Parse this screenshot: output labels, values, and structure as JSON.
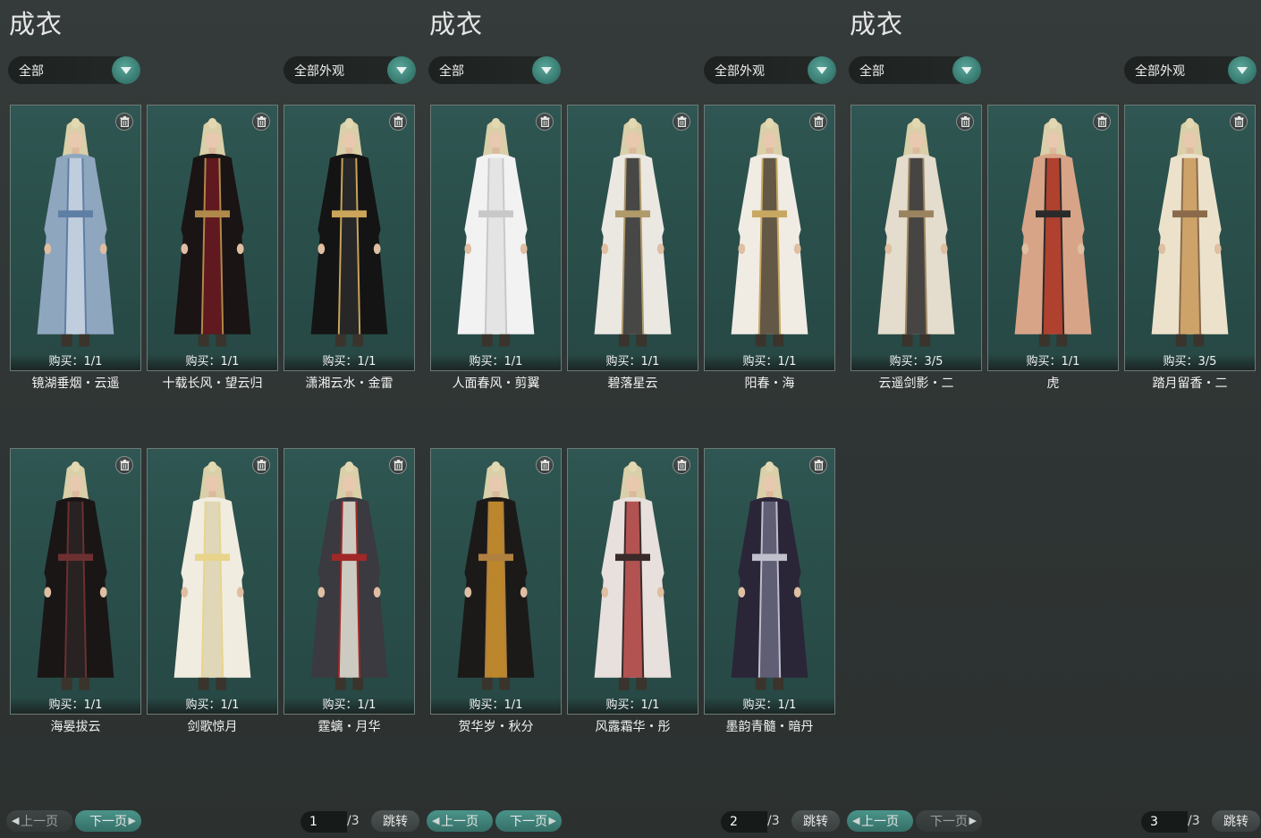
{
  "colors": {
    "accent": "#3a7d73",
    "card_bg": "#2a4f4b",
    "page_bg": "#2f3534"
  },
  "panels": [
    {
      "title": "成衣",
      "filter_left": "全部",
      "filter_right": "全部外观",
      "cards": [
        {
          "buy": "购买：1/1",
          "name": "镜湖垂烟・云遥",
          "palette": [
            "#8fa6bf",
            "#c9d4e2",
            "#5d7fa4"
          ]
        },
        {
          "buy": "购买：1/1",
          "name": "十载长风・望云归",
          "palette": [
            "#1a1414",
            "#6d1a20",
            "#b08a4a"
          ]
        },
        {
          "buy": "购买：1/1",
          "name": "潇湘云水・金雷",
          "palette": [
            "#141414",
            "#2a2a2a",
            "#caa55a"
          ]
        },
        {
          "buy": "购买：1/1",
          "name": "海晏拔云",
          "palette": [
            "#1a1616",
            "#2d2424",
            "#6d3030"
          ]
        },
        {
          "buy": "购买：1/1",
          "name": "剑歌惊月",
          "palette": [
            "#f0ece0",
            "#dcd3b0",
            "#e8d48a"
          ]
        },
        {
          "buy": "购买：1/1",
          "name": "霆螭・月华",
          "palette": [
            "#3a3a40",
            "#e8e4d8",
            "#a02828"
          ]
        }
      ],
      "pager": {
        "prev": "上一页",
        "next": "下一页",
        "page": "1",
        "total": "/3",
        "jump": "跳转"
      }
    },
    {
      "title": "成衣",
      "filter_left": "全部",
      "filter_right": "全部外观",
      "cards": [
        {
          "buy": "购买：1/1",
          "name": "人面春风・剪翼",
          "palette": [
            "#f2f2f2",
            "#e2e2e2",
            "#c8c8c8"
          ]
        },
        {
          "buy": "购买：1/1",
          "name": "碧落星云",
          "palette": [
            "#ebe8e2",
            "#2a2a2a",
            "#b09a6a"
          ]
        },
        {
          "buy": "购买：1/1",
          "name": "阳春・海",
          "palette": [
            "#f0ece4",
            "#4a3e2a",
            "#c8a860"
          ]
        },
        {
          "buy": "购买：1/1",
          "name": "贺华岁・秋分",
          "palette": [
            "#1c1a18",
            "#d89a30",
            "#b08040"
          ]
        },
        {
          "buy": "购买：1/1",
          "name": "风露霜华・彤",
          "palette": [
            "#e8e0dc",
            "#a83a3a",
            "#3a2a2a"
          ]
        },
        {
          "buy": "购买：1/1",
          "name": "墨韵青髓・暗丹",
          "palette": [
            "#2a2638",
            "#6a6880",
            "#c0c0cc"
          ]
        }
      ],
      "pager": {
        "prev": "上一页",
        "next": "下一页",
        "page": "2",
        "total": "/3",
        "jump": "跳转"
      }
    },
    {
      "title": "成衣",
      "filter_left": "全部",
      "filter_right": "全部外观",
      "cards": [
        {
          "buy": "购买：3/5",
          "name": "云遥剑影・二",
          "palette": [
            "#e4dccc",
            "#2a2a2a",
            "#9a8460"
          ]
        },
        {
          "buy": "购买：1/1",
          "name": "虎",
          "palette": [
            "#d8a488",
            "#a8301e",
            "#2a2a2a"
          ]
        },
        {
          "buy": "购买：3/5",
          "name": "踏月留香・二",
          "palette": [
            "#ece2cc",
            "#c89858",
            "#8a6a4a"
          ]
        }
      ],
      "pager": {
        "prev": "上一页",
        "next": "下一页",
        "page": "3",
        "total": "/3",
        "jump": "跳转"
      }
    }
  ]
}
